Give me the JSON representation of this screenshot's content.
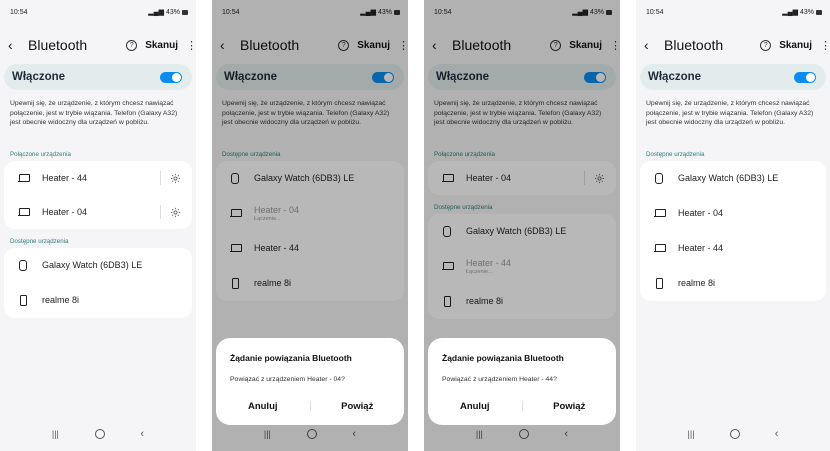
{
  "screens": [
    {
      "status": {
        "time": "10:54",
        "battery": "43%"
      },
      "header": {
        "title": "Bluetooth",
        "scan_label": "Skanuj"
      },
      "toggle": {
        "label": "Włączone"
      },
      "description": "Upewnij się, że urządzenie, z którym chcesz nawiązać połączenie, jest w trybie wiązania. Telefon (Galaxy A32) jest obecnie widoczny dla urządzeń w pobliżu.",
      "paired_label": "Połączone urządzenia",
      "paired": [
        {
          "name": "Heater - 44"
        },
        {
          "name": "Heater - 04"
        }
      ],
      "available_label": "Dostępne urządzenia",
      "available": [
        {
          "name": "Galaxy Watch (6DB3) LE"
        },
        {
          "name": "realme 8i"
        }
      ]
    },
    {
      "status": {
        "time": "10:54",
        "battery": "43%"
      },
      "header": {
        "title": "Bluetooth",
        "scan_label": "Skanuj"
      },
      "toggle": {
        "label": "Włączone"
      },
      "description": "Upewnij się, że urządzenie, z którym chcesz nawiązać połączenie, jest w trybie wiązania. Telefon (Galaxy A32) jest obecnie widoczny dla urządzeń w pobliżu.",
      "available_label": "Dostępne urządzenia",
      "available": [
        {
          "name": "Galaxy Watch (6DB3) LE"
        },
        {
          "name": "Heater - 04",
          "status": "Łączenie..."
        },
        {
          "name": "Heater - 44"
        },
        {
          "name": "realme 8i"
        }
      ],
      "dialog": {
        "title": "Żądanie powiązania Bluetooth",
        "message": "Powiązać z urządzeniem Heater - 04?",
        "cancel": "Anuluj",
        "confirm": "Powiąż"
      }
    },
    {
      "status": {
        "time": "10:54",
        "battery": "43%"
      },
      "header": {
        "title": "Bluetooth",
        "scan_label": "Skanuj"
      },
      "toggle": {
        "label": "Włączone"
      },
      "description": "Upewnij się, że urządzenie, z którym chcesz nawiązać połączenie, jest w trybie wiązania. Telefon (Galaxy A32) jest obecnie widoczny dla urządzeń w pobliżu.",
      "paired_label": "Połączone urządzenia",
      "paired": [
        {
          "name": "Heater - 04"
        }
      ],
      "available_label": "Dostępne urządzenia",
      "available": [
        {
          "name": "Galaxy Watch (6DB3) LE"
        },
        {
          "name": "Heater - 44",
          "status": "Łączenie..."
        },
        {
          "name": "realme 8i"
        }
      ],
      "dialog": {
        "title": "Żądanie powiązania Bluetooth",
        "message": "Powiązać z urządzeniem Heater - 44?",
        "cancel": "Anuluj",
        "confirm": "Powiąż"
      }
    },
    {
      "status": {
        "time": "10:54",
        "battery": "43%"
      },
      "header": {
        "title": "Bluetooth",
        "scan_label": "Skanuj"
      },
      "toggle": {
        "label": "Włączone"
      },
      "description": "Upewnij się, że urządzenie, z którym chcesz nawiązać połączenie, jest w trybie wiązania. Telefon (Galaxy A32) jest obecnie widoczny dla urządzeń w pobliżu.",
      "available_label": "Dostępne urządzenia",
      "available": [
        {
          "name": "Galaxy Watch (6DB3) LE"
        },
        {
          "name": "Heater - 04"
        },
        {
          "name": "Heater - 44"
        },
        {
          "name": "realme 8i"
        }
      ]
    }
  ],
  "colors": {
    "accent": "#0a8cf0",
    "section_label": "#2f7d7a",
    "toggle_bg": "#e2ecec"
  },
  "icons": {
    "paired": "laptop-icon",
    "settings": "gear-icon",
    "watch": "watch-icon",
    "phone": "phone-icon",
    "help": "help-circle-icon"
  }
}
